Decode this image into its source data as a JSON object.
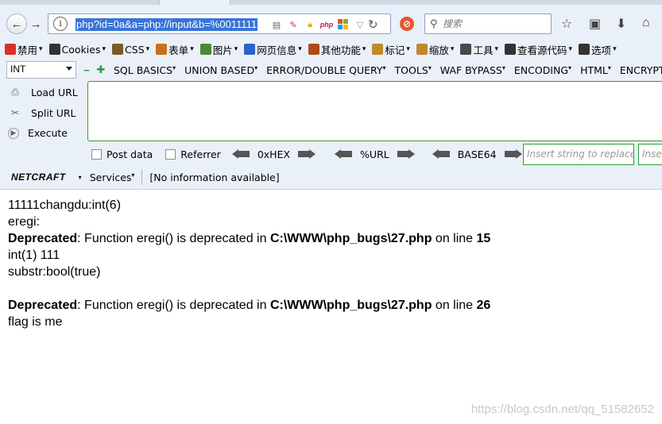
{
  "browser": {
    "url_text": "php?id=0a&a=php://input&b=%0011111",
    "search_placeholder": "搜索",
    "php_badge": "php"
  },
  "menubar": [
    {
      "label": "禁用",
      "icon": "no-icon",
      "color": "#d9302a"
    },
    {
      "label": "Cookies",
      "icon": "person-icon",
      "color": "#333333"
    },
    {
      "label": "CSS",
      "icon": "pencil-icon",
      "color": "#7a5c2a"
    },
    {
      "label": "表单",
      "icon": "form-icon",
      "color": "#c8701e"
    },
    {
      "label": "图片",
      "icon": "image-icon",
      "color": "#4a8a3a"
    },
    {
      "label": "网页信息",
      "icon": "info-icon",
      "color": "#2b63c8"
    },
    {
      "label": "其他功能",
      "icon": "tools-icon",
      "color": "#b04a1a"
    },
    {
      "label": "标记",
      "icon": "marker-icon",
      "color": "#c0892a"
    },
    {
      "label": "缩放",
      "icon": "zoom-icon",
      "color": "#c0892a"
    },
    {
      "label": "工具",
      "icon": "wrench-icon",
      "color": "#4a4a4a"
    },
    {
      "label": "查看源代码",
      "icon": "source-icon",
      "color": "#333333"
    },
    {
      "label": "选项",
      "icon": "options-icon",
      "color": "#333333"
    }
  ],
  "hackbar": {
    "select_value": "INT",
    "menus": [
      "SQL BASICS",
      "UNION BASED",
      "ERROR/DOUBLE QUERY",
      "TOOLS",
      "WAF BYPASS",
      "ENCODING",
      "HTML",
      "ENCRYPTIO"
    ],
    "side": [
      "Load URL",
      "Split URL",
      "Execute"
    ],
    "post_data": "Post data",
    "referrer": "Referrer",
    "hex": "0xHEX",
    "url": "%URL",
    "base64": "BASE64",
    "replace_placeholder": "Insert string to replace",
    "replace2_placeholder": "Inse"
  },
  "netcraft": {
    "logo": "NETCRAFT",
    "services": "Services",
    "info": "[No information available]"
  },
  "output": {
    "line1": "11111changdu:int(6)",
    "line2": "eregi:",
    "dep_label": "Deprecated",
    "dep_msg": ": Function eregi() is deprecated in ",
    "dep_path": "C:\\WWW\\php_bugs\\27.php",
    "dep_on": " on line ",
    "line_15": "15",
    "line3": "int(1) 111",
    "line4": "substr:bool(true)",
    "line_26": "26",
    "line5": "flag is me"
  },
  "watermark": "https://blog.csdn.net/qq_51582652"
}
